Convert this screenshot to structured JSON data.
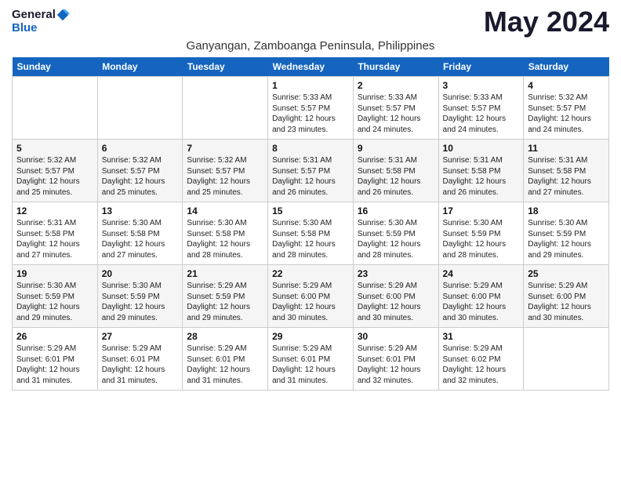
{
  "header": {
    "logo_general": "General",
    "logo_blue": "Blue",
    "month_year": "May 2024",
    "location": "Ganyangan, Zamboanga Peninsula, Philippines"
  },
  "weekdays": [
    "Sunday",
    "Monday",
    "Tuesday",
    "Wednesday",
    "Thursday",
    "Friday",
    "Saturday"
  ],
  "weeks": [
    [
      {
        "day": "",
        "info": ""
      },
      {
        "day": "",
        "info": ""
      },
      {
        "day": "",
        "info": ""
      },
      {
        "day": "1",
        "info": "Sunrise: 5:33 AM\nSunset: 5:57 PM\nDaylight: 12 hours\nand 23 minutes."
      },
      {
        "day": "2",
        "info": "Sunrise: 5:33 AM\nSunset: 5:57 PM\nDaylight: 12 hours\nand 24 minutes."
      },
      {
        "day": "3",
        "info": "Sunrise: 5:33 AM\nSunset: 5:57 PM\nDaylight: 12 hours\nand 24 minutes."
      },
      {
        "day": "4",
        "info": "Sunrise: 5:32 AM\nSunset: 5:57 PM\nDaylight: 12 hours\nand 24 minutes."
      }
    ],
    [
      {
        "day": "5",
        "info": "Sunrise: 5:32 AM\nSunset: 5:57 PM\nDaylight: 12 hours\nand 25 minutes."
      },
      {
        "day": "6",
        "info": "Sunrise: 5:32 AM\nSunset: 5:57 PM\nDaylight: 12 hours\nand 25 minutes."
      },
      {
        "day": "7",
        "info": "Sunrise: 5:32 AM\nSunset: 5:57 PM\nDaylight: 12 hours\nand 25 minutes."
      },
      {
        "day": "8",
        "info": "Sunrise: 5:31 AM\nSunset: 5:57 PM\nDaylight: 12 hours\nand 26 minutes."
      },
      {
        "day": "9",
        "info": "Sunrise: 5:31 AM\nSunset: 5:58 PM\nDaylight: 12 hours\nand 26 minutes."
      },
      {
        "day": "10",
        "info": "Sunrise: 5:31 AM\nSunset: 5:58 PM\nDaylight: 12 hours\nand 26 minutes."
      },
      {
        "day": "11",
        "info": "Sunrise: 5:31 AM\nSunset: 5:58 PM\nDaylight: 12 hours\nand 27 minutes."
      }
    ],
    [
      {
        "day": "12",
        "info": "Sunrise: 5:31 AM\nSunset: 5:58 PM\nDaylight: 12 hours\nand 27 minutes."
      },
      {
        "day": "13",
        "info": "Sunrise: 5:30 AM\nSunset: 5:58 PM\nDaylight: 12 hours\nand 27 minutes."
      },
      {
        "day": "14",
        "info": "Sunrise: 5:30 AM\nSunset: 5:58 PM\nDaylight: 12 hours\nand 28 minutes."
      },
      {
        "day": "15",
        "info": "Sunrise: 5:30 AM\nSunset: 5:58 PM\nDaylight: 12 hours\nand 28 minutes."
      },
      {
        "day": "16",
        "info": "Sunrise: 5:30 AM\nSunset: 5:59 PM\nDaylight: 12 hours\nand 28 minutes."
      },
      {
        "day": "17",
        "info": "Sunrise: 5:30 AM\nSunset: 5:59 PM\nDaylight: 12 hours\nand 28 minutes."
      },
      {
        "day": "18",
        "info": "Sunrise: 5:30 AM\nSunset: 5:59 PM\nDaylight: 12 hours\nand 29 minutes."
      }
    ],
    [
      {
        "day": "19",
        "info": "Sunrise: 5:30 AM\nSunset: 5:59 PM\nDaylight: 12 hours\nand 29 minutes."
      },
      {
        "day": "20",
        "info": "Sunrise: 5:30 AM\nSunset: 5:59 PM\nDaylight: 12 hours\nand 29 minutes."
      },
      {
        "day": "21",
        "info": "Sunrise: 5:29 AM\nSunset: 5:59 PM\nDaylight: 12 hours\nand 29 minutes."
      },
      {
        "day": "22",
        "info": "Sunrise: 5:29 AM\nSunset: 6:00 PM\nDaylight: 12 hours\nand 30 minutes."
      },
      {
        "day": "23",
        "info": "Sunrise: 5:29 AM\nSunset: 6:00 PM\nDaylight: 12 hours\nand 30 minutes."
      },
      {
        "day": "24",
        "info": "Sunrise: 5:29 AM\nSunset: 6:00 PM\nDaylight: 12 hours\nand 30 minutes."
      },
      {
        "day": "25",
        "info": "Sunrise: 5:29 AM\nSunset: 6:00 PM\nDaylight: 12 hours\nand 30 minutes."
      }
    ],
    [
      {
        "day": "26",
        "info": "Sunrise: 5:29 AM\nSunset: 6:01 PM\nDaylight: 12 hours\nand 31 minutes."
      },
      {
        "day": "27",
        "info": "Sunrise: 5:29 AM\nSunset: 6:01 PM\nDaylight: 12 hours\nand 31 minutes."
      },
      {
        "day": "28",
        "info": "Sunrise: 5:29 AM\nSunset: 6:01 PM\nDaylight: 12 hours\nand 31 minutes."
      },
      {
        "day": "29",
        "info": "Sunrise: 5:29 AM\nSunset: 6:01 PM\nDaylight: 12 hours\nand 31 minutes."
      },
      {
        "day": "30",
        "info": "Sunrise: 5:29 AM\nSunset: 6:01 PM\nDaylight: 12 hours\nand 32 minutes."
      },
      {
        "day": "31",
        "info": "Sunrise: 5:29 AM\nSunset: 6:02 PM\nDaylight: 12 hours\nand 32 minutes."
      },
      {
        "day": "",
        "info": ""
      }
    ]
  ]
}
